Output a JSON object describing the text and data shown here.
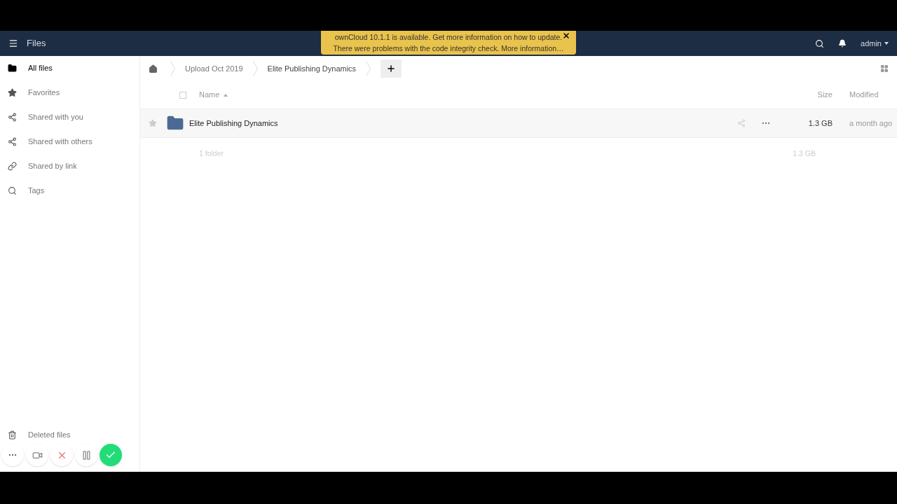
{
  "header": {
    "app_title": "Files",
    "notice": [
      "ownCloud 10.1.1 is available. Get more information on how to update.",
      "There were problems with the code integrity check. More information…"
    ],
    "user": "admin"
  },
  "sidebar": {
    "items": [
      {
        "label": "All files",
        "selected": true
      },
      {
        "label": "Favorites",
        "selected": false
      },
      {
        "label": "Shared with you",
        "selected": false
      },
      {
        "label": "Shared with others",
        "selected": false
      },
      {
        "label": "Shared by link",
        "selected": false
      },
      {
        "label": "Tags",
        "selected": false
      }
    ],
    "bottom_items": [
      {
        "label": "Deleted files"
      }
    ]
  },
  "breadcrumbs": [
    "Upload Oct 2019",
    "Elite Publishing Dynamics"
  ],
  "table": {
    "select_all_checked": false,
    "columns": [
      "Name",
      "Size",
      "Modified"
    ],
    "rows": [
      {
        "name": "Elite Publishing Dynamics",
        "size": "1.3 GB",
        "modified": "a month ago",
        "favorite": false
      }
    ],
    "summary": {
      "count": "1 folder",
      "size": "1.3 GB"
    }
  },
  "recorder": {
    "buttons": [
      {
        "kind": "more"
      },
      {
        "kind": "camera"
      },
      {
        "kind": "cancel"
      },
      {
        "kind": "pause"
      },
      {
        "kind": "done"
      }
    ]
  }
}
